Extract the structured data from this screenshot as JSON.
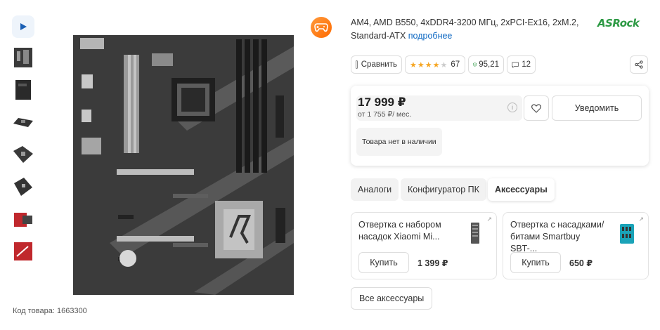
{
  "product": {
    "description": "AM4, AMD B550, 4xDDR4-3200 МГц, 2xPCI-Ex16, 2xM.2, Standard-ATX",
    "more_link": "подробнее",
    "brand": "ASRock",
    "code_label": "Код товара: 1663300"
  },
  "actions": {
    "compare_label": "Сравнить",
    "rating_stars": 4,
    "reviews_count": "67",
    "reliability": "95,21",
    "comments_count": "12"
  },
  "price": {
    "value": "17 999 ₽",
    "installment": "от 1 755 ₽/ мес.",
    "notify_label": "Уведомить",
    "stock_text": "Товара нет в наличии"
  },
  "tabs": [
    {
      "label": "Аналоги"
    },
    {
      "label": "Конфигуратор ПК"
    },
    {
      "label": "Аксессуары",
      "active": true
    }
  ],
  "accessories": [
    {
      "name": "Отвертка с набором насадок Xiaomi Mi...",
      "buy_label": "Купить",
      "price": "1 399 ₽"
    },
    {
      "name": "Отвертка с насадками/битами Smartbuy SBT-...",
      "buy_label": "Купить",
      "price": "650 ₽"
    }
  ],
  "all_accessories_label": "Все аксессуары",
  "colors": {
    "brand_green": "#2e9a45",
    "link": "#0a66c2",
    "star": "#f6a623",
    "game_orange": "#ff7a1a"
  }
}
